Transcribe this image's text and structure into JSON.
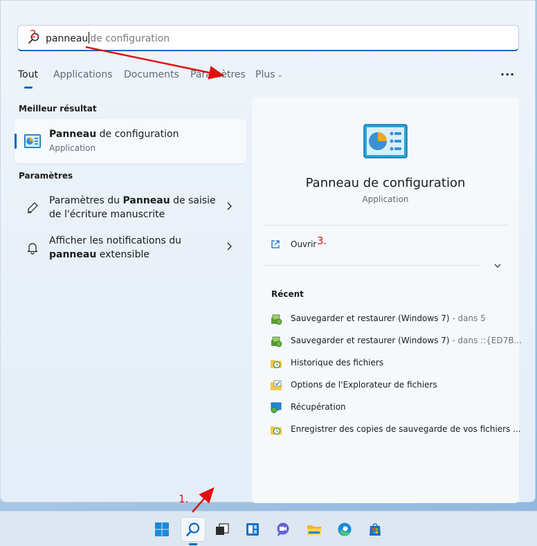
{
  "search": {
    "typed": "panneau",
    "suggestion": "de configuration",
    "placeholder": "panneau de configuration"
  },
  "tabs": [
    {
      "label": "Tout"
    },
    {
      "label": "Applications"
    },
    {
      "label": "Documents"
    },
    {
      "label": "Paramètres"
    },
    {
      "label": "Plus"
    }
  ],
  "sections": {
    "best": "Meilleur résultat",
    "settings": "Paramètres"
  },
  "best_result": {
    "title_bold": "Panneau",
    "title_rest": " de configuration",
    "subtitle": "Application"
  },
  "settings_items": [
    {
      "line1": "Paramètres du ",
      "bold": "Panneau",
      "line1_end": " de saisie",
      "line2": "de l'écriture manuscrite",
      "icon": "pen-icon"
    },
    {
      "line1": "Afficher les notifications du",
      "bold": "panneau",
      "line2_end": " extensible",
      "icon": "bell-icon"
    }
  ],
  "details": {
    "title": "Panneau de configuration",
    "subtitle": "Application",
    "open_label": "Ouvrir",
    "recent_title": "Récent",
    "recent": [
      {
        "text": "Sauvegarder et restaurer (Windows 7)",
        "extra": " - dans 5",
        "icon": "backup-icon"
      },
      {
        "text": "Sauvegarder et restaurer (Windows 7)",
        "extra": " - dans ::{ED7B...",
        "icon": "backup-icon"
      },
      {
        "text": "Historique des fichiers",
        "extra": "",
        "icon": "file-history-icon"
      },
      {
        "text": "Options de l'Explorateur de fichiers",
        "extra": "",
        "icon": "folder-options-icon"
      },
      {
        "text": "Récupération",
        "extra": "",
        "icon": "recovery-icon"
      },
      {
        "text": "Enregistrer des copies de sauvegarde de vos fichiers ...",
        "extra": "",
        "icon": "file-history-icon"
      }
    ]
  },
  "annotations": {
    "step1": "1.",
    "step2": "2.",
    "step3": "3."
  },
  "taskbar": [
    "windows-start-icon",
    "search-icon",
    "task-view-icon",
    "widgets-icon",
    "chat-icon",
    "file-explorer-icon",
    "edge-icon",
    "store-icon"
  ],
  "colors": {
    "accent": "#0067c0",
    "annotation": "#e01010"
  }
}
